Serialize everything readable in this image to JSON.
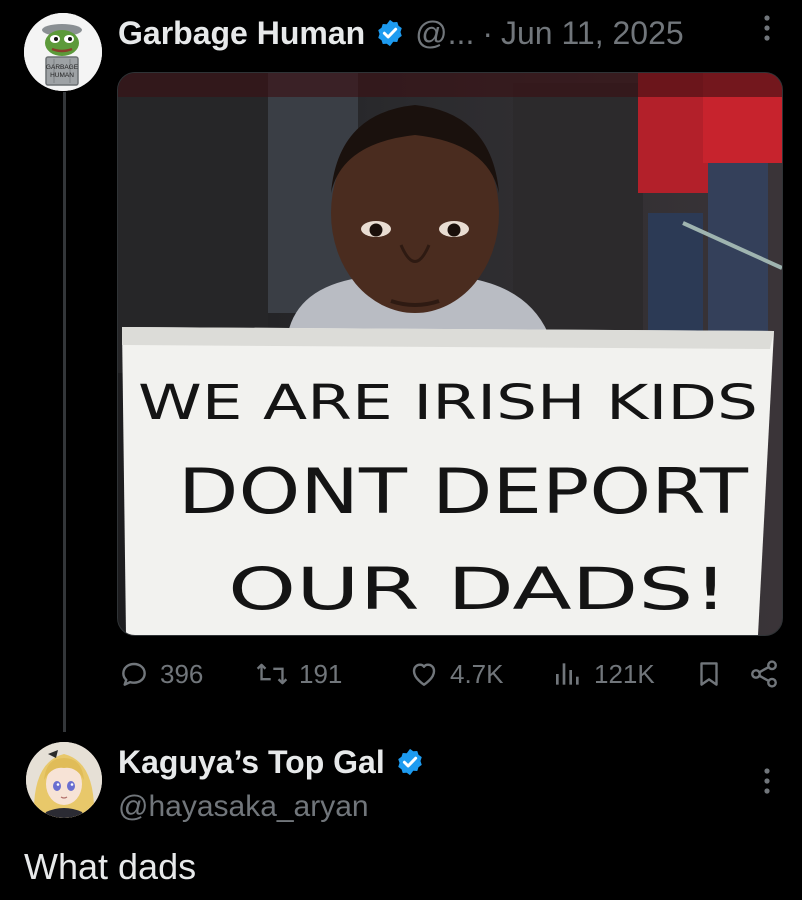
{
  "tweet": {
    "author_name": "Garbage Human",
    "handle": "@...",
    "separator": "·",
    "date": "Jun 11, 2025",
    "avatar_text_top": "GARBAGE",
    "avatar_text_bottom": "HUMAN",
    "sign_lines": [
      "WE ARE IRISH KIDS",
      "DONT DEPORT",
      "OUR DADS!"
    ],
    "stats": {
      "replies": "396",
      "retweets": "191",
      "likes": "4.7K",
      "views": "121K"
    }
  },
  "reply": {
    "author_name": "Kaguya’s Top Gal",
    "handle": "@hayasaka_aryan",
    "text": "What dads"
  },
  "colors": {
    "background": "#000000",
    "text": "#e7e9ea",
    "muted": "#71767b",
    "verified": "#1d9bf0"
  }
}
